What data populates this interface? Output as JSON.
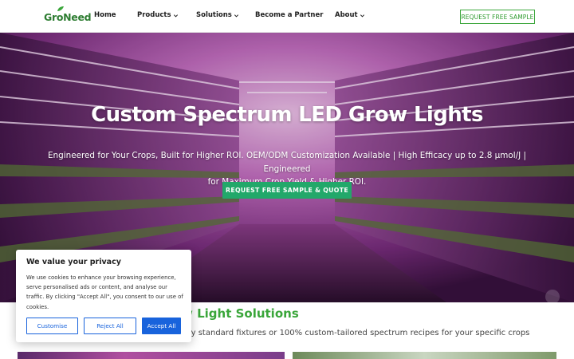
{
  "header": {
    "logo_text": "GroNeed",
    "nav": [
      {
        "label": "Home",
        "has_dropdown": false
      },
      {
        "label": "Products",
        "has_dropdown": true
      },
      {
        "label": "Solutions",
        "has_dropdown": true
      },
      {
        "label": "Become a Partner",
        "has_dropdown": false
      },
      {
        "label": "About",
        "has_dropdown": true
      }
    ],
    "cta_label": "REQUEST FREE SAMPLE"
  },
  "hero": {
    "title": "Custom Spectrum LED Grow Lights",
    "subtitle_line1": "Engineered for Your Crops, Built for Higher ROI.   OEM/ODM Customization Available | High Efficacy up to 2.8 µmol/J | Engineered",
    "subtitle_line2": "for Maximum Crop Yield & Higher ROI.",
    "button_label": "REQUEST FREE SAMPLE & QUOTE"
  },
  "section": {
    "title_visible": "w Light Solutions",
    "subtitle_visible": "acy standard fixtures or 100% custom-tailored spectrum recipes for your specific crops"
  },
  "cookie": {
    "title": "We value your privacy",
    "text": "We use cookies to enhance your browsing experience, serve personalised ads or content, and analyse our traffic. By clicking \"Accept All\", you consent to our use of cookies.",
    "customise_label": "Customise",
    "reject_label": "Reject All",
    "accept_label": "Accept All"
  },
  "colors": {
    "brand_green": "#3aa63a",
    "hero_button": "#22a86a",
    "cookie_blue": "#1863dc",
    "hero_tint": "#a23aa8"
  },
  "icons": [
    "leaf-icon",
    "chevron-down-icon",
    "scroll-top-icon"
  ]
}
